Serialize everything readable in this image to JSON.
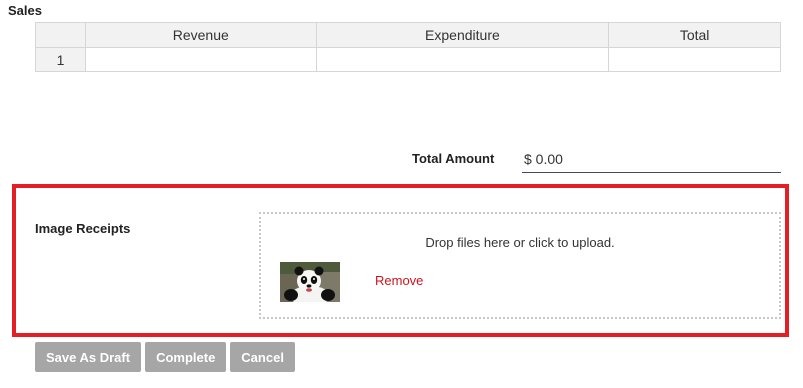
{
  "sales": {
    "title": "Sales",
    "columns": [
      "Revenue",
      "Expenditure",
      "Total"
    ],
    "rows": [
      {
        "num": "1",
        "revenue": "",
        "expenditure": "",
        "total": ""
      }
    ]
  },
  "total_amount": {
    "label": "Total Amount",
    "value": "$ 0.00"
  },
  "image_receipts": {
    "label": "Image Receipts",
    "dropzone_text": "Drop files here or click to upload.",
    "files": [
      {
        "thumbnail": "panda-photo",
        "remove_label": "Remove"
      }
    ]
  },
  "actions": {
    "save_draft": "Save As Draft",
    "complete": "Complete",
    "cancel": "Cancel"
  },
  "colors": {
    "highlight_border": "#e41e25",
    "remove_link": "#d0131d",
    "button_bg": "#a6a6a6"
  }
}
